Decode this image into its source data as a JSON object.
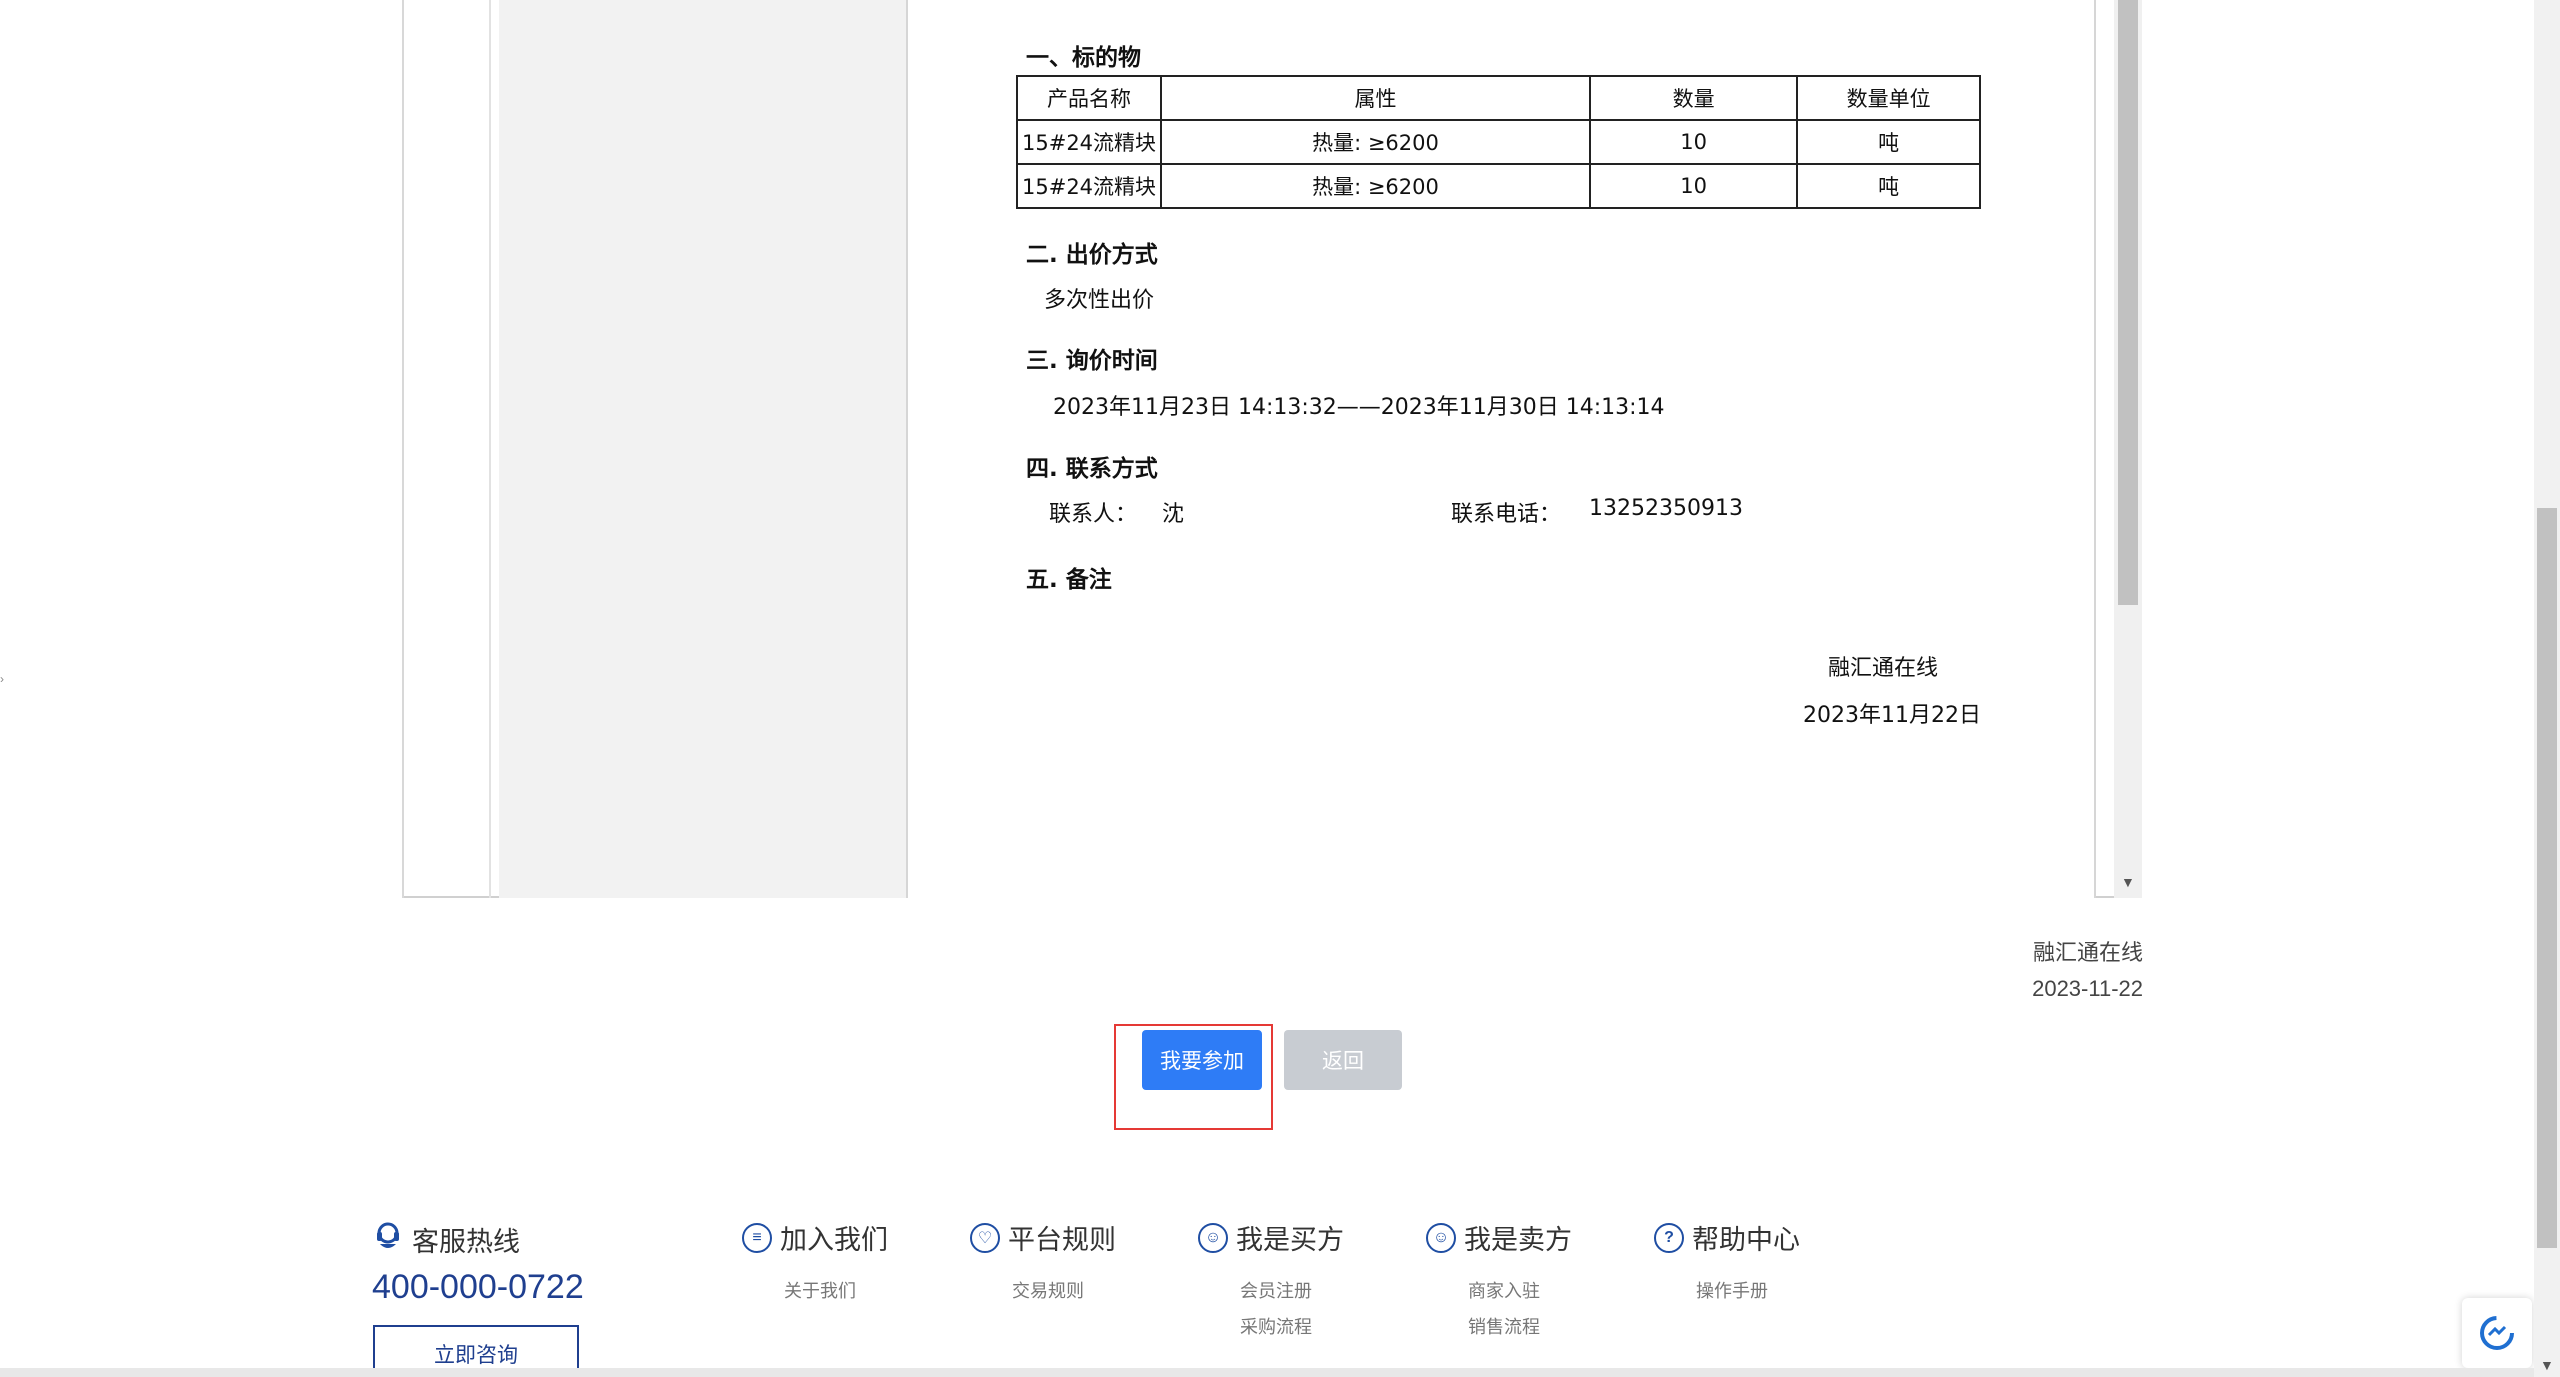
{
  "document": {
    "section1_title": "一、标的物",
    "table": {
      "headers": [
        "产品名称",
        "属性",
        "数量",
        "数量单位"
      ],
      "rows": [
        [
          "15#24流精块",
          "热量: ≥6200",
          "10",
          "吨"
        ],
        [
          "15#24流精块",
          "热量: ≥6200",
          "10",
          "吨"
        ]
      ]
    },
    "section2_title": "二. 出价方式",
    "bid_method": "多次性出价",
    "section3_title": "三. 询价时间",
    "inquiry_time": "2023年11月23日 14:13:32——2023年11月30日 14:13:14",
    "section4_title": "四. 联系方式",
    "contact_label": "联系人：",
    "contact_name": "沈",
    "phone_label": "联系电话：",
    "phone_value": "13252350913",
    "section5_title": "五. 备注",
    "signature": "融汇通在线",
    "signature_date": "2023年11月22日"
  },
  "meta": {
    "publisher": "融汇通在线",
    "date": "2023-11-22"
  },
  "actions": {
    "join_label": "我要参加",
    "back_label": "返回"
  },
  "footer": {
    "hotline_title": "客服热线",
    "hotline_number": "400-000-0722",
    "consult_label": "立即咨询",
    "columns": [
      {
        "title": "加入我们",
        "links": [
          "关于我们"
        ]
      },
      {
        "title": "平台规则",
        "links": [
          "交易规则"
        ]
      },
      {
        "title": "我是买方",
        "links": [
          "会员注册",
          "采购流程"
        ]
      },
      {
        "title": "我是卖方",
        "links": [
          "商家入驻",
          "销售流程"
        ]
      },
      {
        "title": "帮助中心",
        "links": [
          "操作手册"
        ]
      }
    ]
  },
  "colors": {
    "primary": "#2e7cf6",
    "disabled": "#c8ccd2",
    "highlight": "#e53935",
    "brand_dark": "#1f3f8f"
  }
}
